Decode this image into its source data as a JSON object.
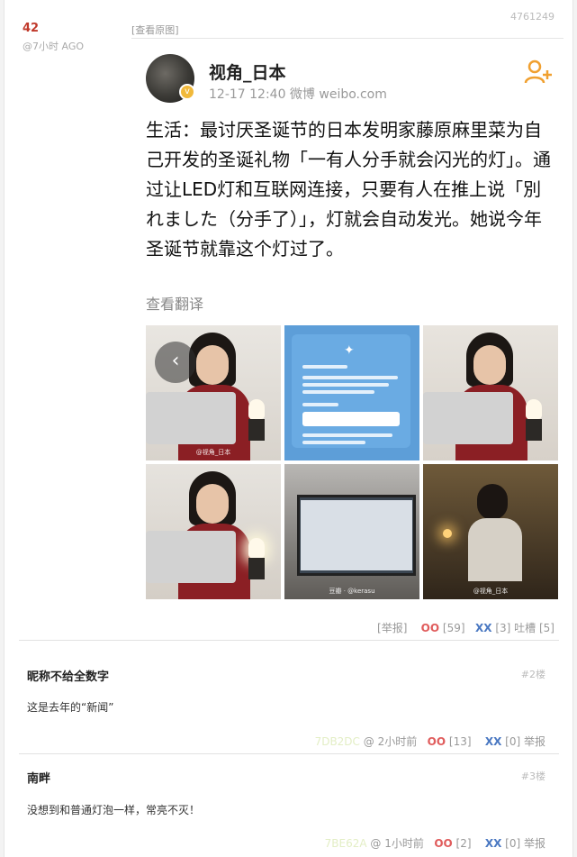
{
  "post": {
    "number": "42",
    "time": "@7小时 AGO",
    "id": "4761249",
    "view_original": "[查看原图]"
  },
  "weibo": {
    "author": "视角_日本",
    "meta": "12-17 12:40  微博 weibo.com",
    "text": "生活：最讨厌圣诞节的日本发明家藤原麻里菜为自己开发的圣诞礼物「一有人分手就会闪光的灯」。通过让LED灯和互联网连接，只要有人在推上说「別れました（分手了）」，灯就会自动发光。她说今年圣诞节就靠这个灯过了。",
    "translate": "查看翻译",
    "photo_watermark_1": "@视角_日本",
    "photo_watermark_5": "豆瓣 · @kerasu",
    "photo_watermark_6": "@视角_日本"
  },
  "main_actions": {
    "report": "[举报]",
    "oo": "OO",
    "oo_count": "[59]",
    "xx": "XX",
    "xx_count": "[3]",
    "tucao": "吐槽 [5]"
  },
  "comments": [
    {
      "name": "昵称不给全数字",
      "floor": "#2楼",
      "text": "这是去年的“新闻”",
      "user_id": "7DB2DC",
      "time": "@ 2小时前",
      "oo": "OO",
      "oo_count": "[13]",
      "xx": "XX",
      "xx_count": "[0]",
      "report": "举报"
    },
    {
      "name": "南畔",
      "floor": "#3楼",
      "text": "没想到和普通灯泡一样，常亮不灭！",
      "user_id": "7BE62A",
      "time": "@ 1小时前",
      "oo": "OO",
      "oo_count": "[2]",
      "xx": "XX",
      "xx_count": "[0]",
      "report": "举报"
    }
  ],
  "colors": {
    "oo": "#e05c5c",
    "xx": "#4a78c2",
    "number": "#c0392b"
  }
}
